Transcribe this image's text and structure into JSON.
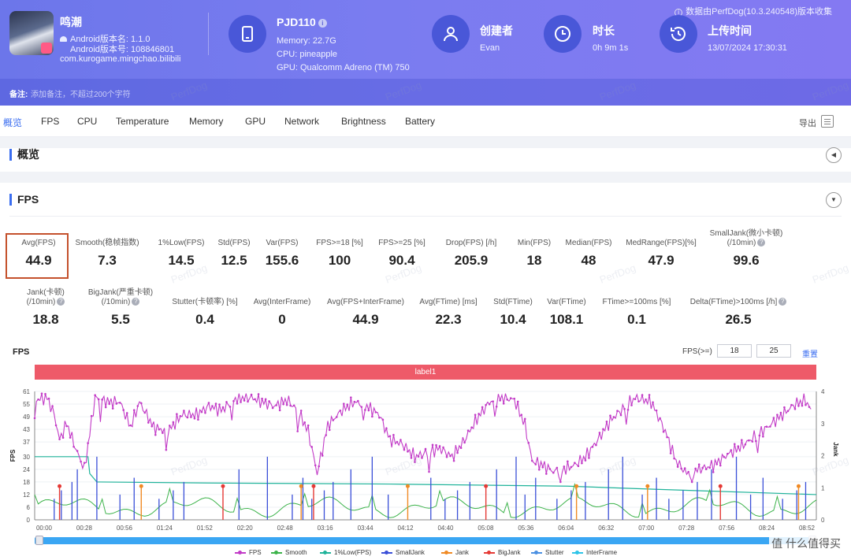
{
  "header": {
    "notice": "数据由PerfDog(10.3.240548)版本收集",
    "app": {
      "name": "鸣潮",
      "version_name_line": "Android版本名: 1.1.0",
      "version_code_line": "Android版本号: 108846801",
      "package": "com.kurogame.mingchao.bilibili"
    },
    "device": {
      "model": "PJD110",
      "memory": "Memory: 22.7G",
      "cpu": "CPU: pineapple",
      "gpu": "GPU: Qualcomm Adreno (TM) 750"
    },
    "creator": {
      "label": "创建者",
      "value": "Evan"
    },
    "duration": {
      "label": "时长",
      "value": "0h 9m 1s"
    },
    "upload": {
      "label": "上传时间",
      "value": "13/07/2024 17:30:31"
    },
    "remark_label": "备注:",
    "remark_placeholder": "添加备注，不超过200个字符"
  },
  "tabs": [
    "概览",
    "FPS",
    "CPU",
    "Temperature",
    "Memory",
    "GPU",
    "Network",
    "Brightness",
    "Battery"
  ],
  "export_label": "导出",
  "sections": {
    "overview": "概览",
    "fps": "FPS"
  },
  "metrics_row1": [
    {
      "label": "Avg(FPS)",
      "value": "44.9"
    },
    {
      "label": "Smooth(稳帧指数)",
      "value": "7.3"
    },
    {
      "label": "1%Low(FPS)",
      "value": "14.5"
    },
    {
      "label": "Std(FPS)",
      "value": "12.5"
    },
    {
      "label": "Var(FPS)",
      "value": "155.6"
    },
    {
      "label": "FPS>=18 [%]",
      "value": "100"
    },
    {
      "label": "FPS>=25 [%]",
      "value": "90.4"
    },
    {
      "label": "Drop(FPS) [/h]",
      "value": "205.9"
    },
    {
      "label": "Min(FPS)",
      "value": "18"
    },
    {
      "label": "Median(FPS)",
      "value": "48"
    },
    {
      "label": "MedRange(FPS)[%]",
      "value": "47.9"
    },
    {
      "label": "SmallJank(微小卡顿)",
      "label2": "(/10min)",
      "value": "99.6"
    }
  ],
  "metrics_row2": [
    {
      "label": "Jank(卡顿)",
      "label2": "(/10min)",
      "value": "18.8"
    },
    {
      "label": "BigJank(严重卡顿)",
      "label2": "(/10min)",
      "value": "5.5"
    },
    {
      "label": "Stutter(卡顿率) [%]",
      "value": "0.4"
    },
    {
      "label": "Avg(InterFrame)",
      "value": "0"
    },
    {
      "label": "Avg(FPS+InterFrame)",
      "value": "44.9"
    },
    {
      "label": "Avg(FTime) [ms]",
      "value": "22.3"
    },
    {
      "label": "Std(FTime)",
      "value": "10.4"
    },
    {
      "label": "Var(FTime)",
      "value": "108.1"
    },
    {
      "label": "FTime>=100ms [%]",
      "value": "0.1"
    },
    {
      "label": "Delta(FTime)>100ms [/h]",
      "value": "26.5"
    }
  ],
  "chart": {
    "label": "FPS",
    "filter_label": "FPS(>=)",
    "filter_values": [
      "18",
      "25"
    ],
    "reset_label": "重置",
    "band_label": "label1",
    "watermark": "PerfDog",
    "corner_logo": "值 什么值得买"
  },
  "chart_data": {
    "type": "line",
    "title": "",
    "x_ticks": [
      "00:00",
      "00:28",
      "00:56",
      "01:24",
      "01:52",
      "02:20",
      "02:48",
      "03:16",
      "03:44",
      "04:12",
      "04:40",
      "05:08",
      "05:36",
      "06:04",
      "06:32",
      "07:00",
      "07:28",
      "07:56",
      "08:24",
      "08:52"
    ],
    "ylabel_left": "FPS",
    "ylabel_right": "Jank",
    "y_left_ticks": [
      0,
      6,
      12,
      18,
      24,
      30,
      37,
      43,
      49,
      55,
      61
    ],
    "y_left_range": [
      0,
      61
    ],
    "y_right_ticks": [
      0,
      1,
      2,
      3,
      4
    ],
    "y_right_range": [
      0,
      4
    ],
    "legend": [
      {
        "name": "FPS",
        "color": "#c23bc7"
      },
      {
        "name": "Smooth",
        "color": "#3cb34a"
      },
      {
        "name": "1%Low(FPS)",
        "color": "#1fb39a"
      },
      {
        "name": "SmallJank",
        "color": "#3a4fd8"
      },
      {
        "name": "Jank",
        "color": "#f08a24"
      },
      {
        "name": "BigJank",
        "color": "#e53935"
      },
      {
        "name": "Stutter",
        "color": "#4a90e2"
      },
      {
        "name": "InterFrame",
        "color": "#2ec4e8"
      }
    ],
    "fps_series_approx": [
      {
        "t": 0,
        "v": 57
      },
      {
        "t": 14,
        "v": 58
      },
      {
        "t": 22,
        "v": 50
      },
      {
        "t": 28,
        "v": 38
      },
      {
        "t": 36,
        "v": 46
      },
      {
        "t": 46,
        "v": 34
      },
      {
        "t": 56,
        "v": 24
      },
      {
        "t": 68,
        "v": 58
      },
      {
        "t": 84,
        "v": 56
      },
      {
        "t": 96,
        "v": 56
      },
      {
        "t": 108,
        "v": 44
      },
      {
        "t": 118,
        "v": 56
      },
      {
        "t": 134,
        "v": 44
      },
      {
        "t": 150,
        "v": 42
      },
      {
        "t": 166,
        "v": 50
      },
      {
        "t": 182,
        "v": 50
      },
      {
        "t": 196,
        "v": 54
      },
      {
        "t": 210,
        "v": 52
      },
      {
        "t": 228,
        "v": 58
      },
      {
        "t": 244,
        "v": 58
      },
      {
        "t": 256,
        "v": 56
      },
      {
        "t": 270,
        "v": 54
      },
      {
        "t": 284,
        "v": 57
      },
      {
        "t": 296,
        "v": 52
      },
      {
        "t": 308,
        "v": 42
      },
      {
        "t": 318,
        "v": 22
      },
      {
        "t": 330,
        "v": 45
      },
      {
        "t": 346,
        "v": 52
      },
      {
        "t": 360,
        "v": 56
      },
      {
        "t": 374,
        "v": 54
      },
      {
        "t": 388,
        "v": 50
      },
      {
        "t": 400,
        "v": 38
      },
      {
        "t": 414,
        "v": 36
      },
      {
        "t": 428,
        "v": 30
      },
      {
        "t": 442,
        "v": 32
      },
      {
        "t": 456,
        "v": 34
      },
      {
        "t": 470,
        "v": 30
      },
      {
        "t": 484,
        "v": 38
      },
      {
        "t": 498,
        "v": 48
      },
      {
        "t": 512,
        "v": 56
      },
      {
        "t": 526,
        "v": 58
      },
      {
        "t": 540,
        "v": 57
      },
      {
        "t": 552,
        "v": 45
      },
      {
        "t": 560,
        "v": 28
      },
      {
        "t": 572,
        "v": 26
      },
      {
        "t": 584,
        "v": 23
      },
      {
        "t": 596,
        "v": 24
      },
      {
        "t": 608,
        "v": 26
      },
      {
        "t": 620,
        "v": 30
      },
      {
        "t": 634,
        "v": 38
      },
      {
        "t": 648,
        "v": 47
      },
      {
        "t": 660,
        "v": 52
      },
      {
        "t": 676,
        "v": 58
      },
      {
        "t": 694,
        "v": 56
      },
      {
        "t": 710,
        "v": 42
      },
      {
        "t": 722,
        "v": 28
      },
      {
        "t": 734,
        "v": 22
      },
      {
        "t": 748,
        "v": 24
      },
      {
        "t": 764,
        "v": 26
      },
      {
        "t": 780,
        "v": 31
      },
      {
        "t": 796,
        "v": 35
      },
      {
        "t": 812,
        "v": 40
      },
      {
        "t": 828,
        "v": 45
      },
      {
        "t": 842,
        "v": 50
      },
      {
        "t": 856,
        "v": 55
      },
      {
        "t": 868,
        "v": 57
      },
      {
        "t": 876,
        "v": 50
      }
    ],
    "x_range_seconds": [
      0,
      880
    ]
  }
}
